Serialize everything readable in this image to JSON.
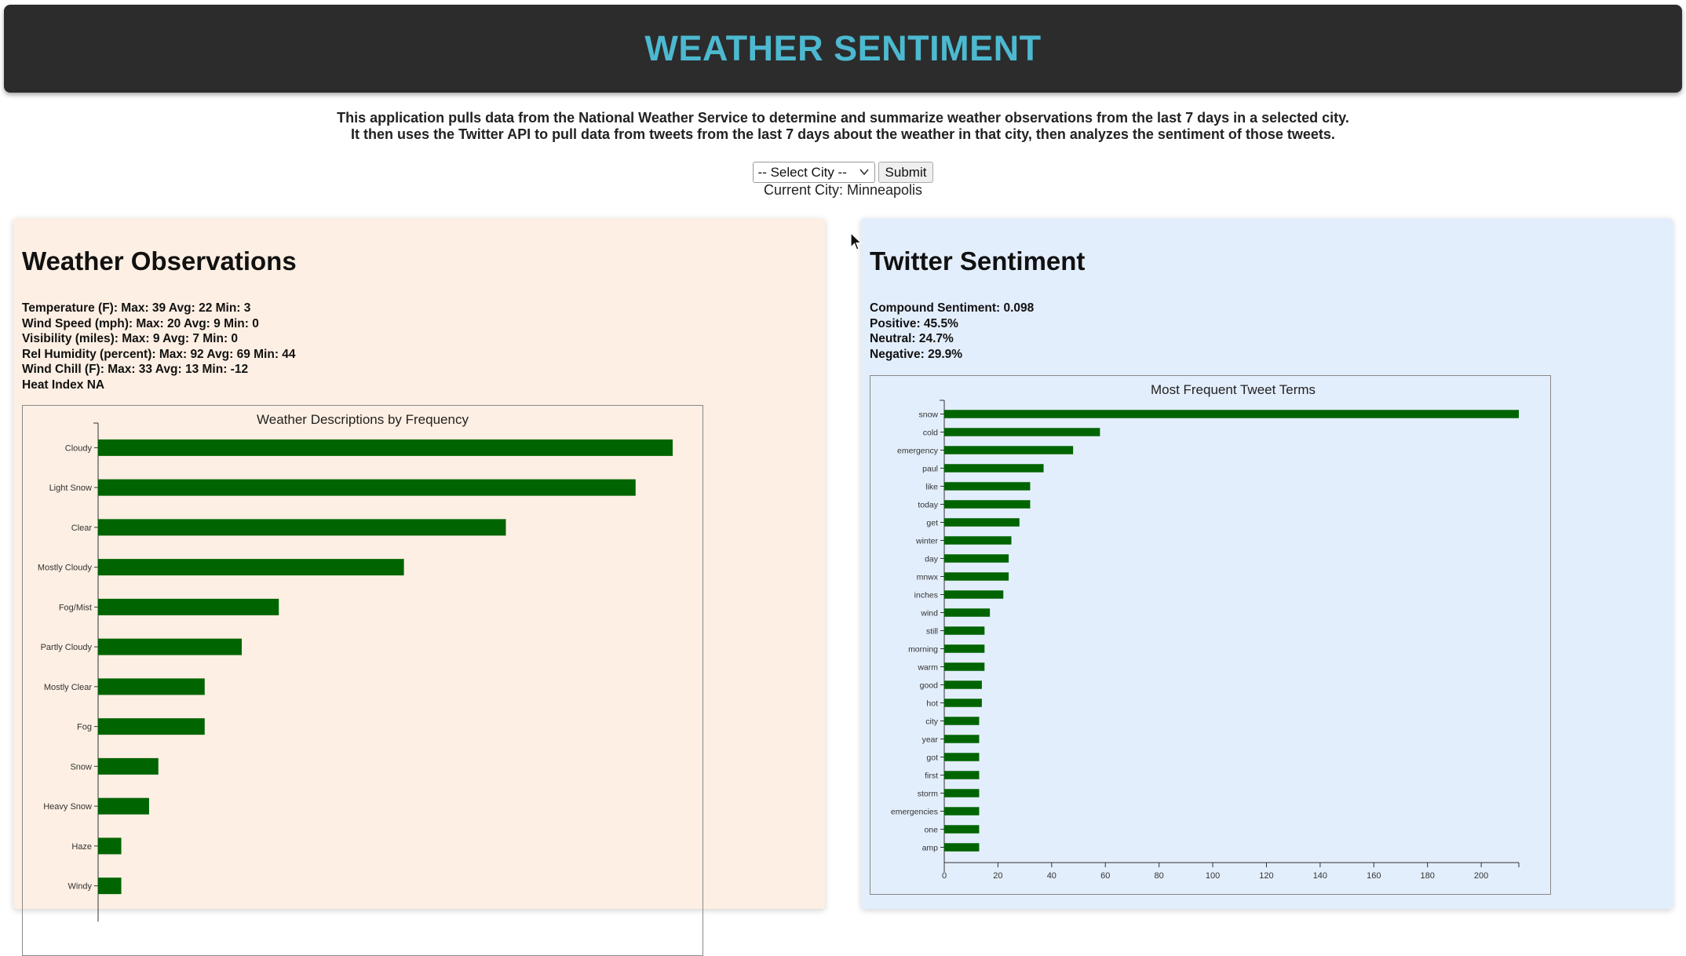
{
  "header": {
    "title": "WEATHER SENTIMENT",
    "title_color": "#4cb9d0",
    "background": "#2c2c2c"
  },
  "intro": {
    "line1": "This application pulls data from the National Weather Service to determine and summarize weather observations from the last 7 days in a selected city.",
    "line2": "It then uses the Twitter API to pull data from tweets from the last 7 days about the weather in that city, then analyzes the sentiment of those tweets."
  },
  "controls": {
    "select_value": "-- Select City --",
    "submit_label": "Submit",
    "current_city": "Current City: Minneapolis"
  },
  "weather": {
    "title": "Weather Observations",
    "background": "#fdefe3",
    "stats": [
      "Temperature (F): Max: 39 Avg: 22 Min: 3",
      "Wind Speed (mph): Max: 20 Avg: 9 Min: 0",
      "Visibility (miles): Max: 9 Avg: 7 Min: 0",
      "Rel Humidity (percent): Max: 92 Avg: 69 Min: 44",
      "Wind Chill (F): Max: 33 Avg: 13 Min: -12",
      "Heat Index NA"
    ]
  },
  "twitter": {
    "title": "Twitter Sentiment",
    "background": "#e3eefc",
    "stats": [
      "Compound Sentiment: 0.098",
      "Positive: 45.5%",
      "Neutral: 24.7%",
      "Negative: 29.9%"
    ]
  },
  "chart_data": [
    {
      "type": "bar",
      "orientation": "horizontal",
      "title": "Weather Descriptions by Frequency",
      "bar_color": "#006400",
      "categories": [
        "Cloudy",
        "Light Snow",
        "Clear",
        "Mostly Cloudy",
        "Fog/Mist",
        "Partly Cloudy",
        "Mostly Clear",
        "Fog",
        "Snow",
        "Heavy Snow",
        "Haze",
        "Windy"
      ],
      "values": [
        62,
        58,
        44,
        33,
        19.5,
        15.5,
        11.5,
        11.5,
        6.5,
        5.5,
        2.5,
        2.5
      ],
      "xlim": [
        0,
        62
      ]
    },
    {
      "type": "bar",
      "orientation": "horizontal",
      "title": "Most Frequent Tweet Terms",
      "bar_color": "#006400",
      "categories": [
        "snow",
        "cold",
        "emergency",
        "paul",
        "like",
        "today",
        "get",
        "winter",
        "day",
        "mnwx",
        "inches",
        "wind",
        "still",
        "morning",
        "warm",
        "good",
        "hot",
        "city",
        "year",
        "got",
        "first",
        "storm",
        "emergencies",
        "one",
        "amp"
      ],
      "values": [
        214,
        58,
        48,
        37,
        32,
        32,
        28,
        25,
        24,
        24,
        22,
        17,
        15,
        15,
        15,
        14,
        14,
        13,
        13,
        13,
        13,
        13,
        13,
        13,
        13
      ],
      "xlim": [
        0,
        214
      ],
      "xticks": [
        0,
        20,
        40,
        60,
        80,
        100,
        120,
        140,
        160,
        180,
        200
      ]
    }
  ]
}
